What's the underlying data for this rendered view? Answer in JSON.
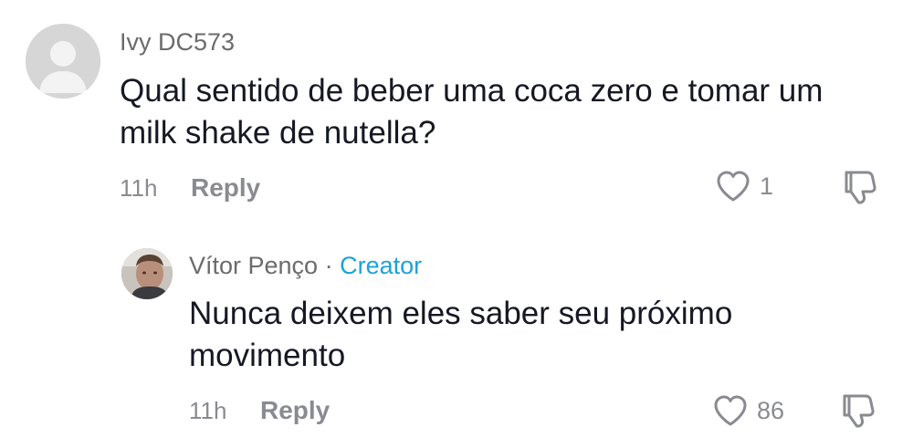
{
  "comment": {
    "username": "Ivy DC573",
    "text_line1": "Qual sentido de beber uma coca zero e tomar um",
    "text_line2": "milk shake de nutella?",
    "time": "11h",
    "reply_label": "Reply",
    "like_count": "1"
  },
  "reply": {
    "username": "Vítor Penço",
    "separator": "·",
    "badge": "Creator",
    "text_line1": "Nunca deixem eles saber seu próximo",
    "text_line2": "movimento",
    "time": "11h",
    "reply_label": "Reply",
    "like_count": "86"
  },
  "colors": {
    "creator_badge": "#1da2d8",
    "meta_gray": "#8a8b91",
    "text": "#161823"
  },
  "icons": {
    "like": "heart-outline-icon",
    "dislike": "thumbs-down-outline-icon",
    "default_avatar": "default-user-avatar"
  }
}
